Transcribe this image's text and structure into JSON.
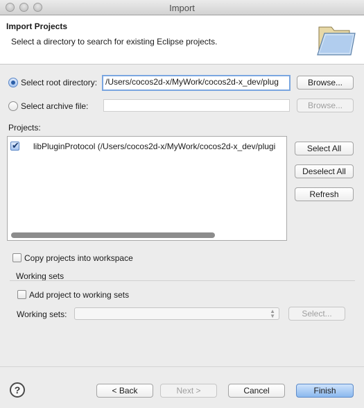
{
  "window": {
    "title": "Import"
  },
  "banner": {
    "title": "Import Projects",
    "description": "Select a directory to search for existing Eclipse projects."
  },
  "source": {
    "root_label": "Select root directory:",
    "root_value": "/Users/cocos2d-x/MyWork/cocos2d-x_dev/plug",
    "root_selected": true,
    "archive_label": "Select archive file:",
    "archive_value": "",
    "browse_label": "Browse..."
  },
  "projects": {
    "label": "Projects:",
    "items": [
      {
        "name": "libPluginProtocol (/Users/cocos2d-x/MyWork/cocos2d-x_dev/plugi",
        "checked": true
      }
    ],
    "select_all": "Select All",
    "deselect_all": "Deselect All",
    "refresh": "Refresh"
  },
  "options": {
    "copy_label": "Copy projects into workspace",
    "copy_checked": false
  },
  "working_sets": {
    "group_label": "Working sets",
    "add_label": "Add project to working sets",
    "add_checked": false,
    "field_label": "Working sets:",
    "select_label": "Select..."
  },
  "footer": {
    "help": "?",
    "back": "< Back",
    "next": "Next >",
    "cancel": "Cancel",
    "finish": "Finish"
  },
  "colors": {
    "accent": "#5d8ac8",
    "banner_bg": "#ffffff",
    "window_bg": "#ececec"
  }
}
